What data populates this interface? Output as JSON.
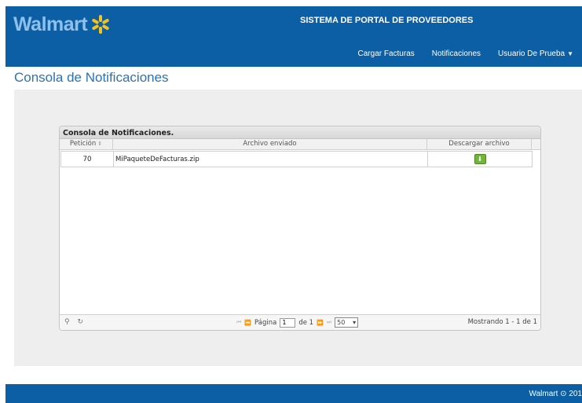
{
  "header": {
    "logo_text": "Walmart",
    "portal_title": "SISTEMA DE PORTAL DE PROVEEDORES",
    "nav": {
      "upload": "Cargar Facturas",
      "notifications": "Notificaciones",
      "user": "Usuario De Prueba"
    }
  },
  "page": {
    "title": "Consola de Notificaciones"
  },
  "grid": {
    "caption": "Consola de Notificaciones.",
    "columns": {
      "peticion": "Petición",
      "archivo": "Archivo enviado",
      "descargar": "Descargar archivo"
    },
    "rows": [
      {
        "peticion": "70",
        "archivo": "MiPaqueteDeFacturas.zip"
      }
    ],
    "pager": {
      "page_label": "Página",
      "page_value": "1",
      "of_label": "de 1",
      "page_size": "50",
      "showing": "Mostrando 1 - 1 de 1"
    }
  },
  "footer": {
    "text": "Walmart ⊙ 201"
  },
  "colors": {
    "brand_blue": "#0d5fa5",
    "logo_blue": "#8ec0ec",
    "spark_yellow": "#f7c21a",
    "download_green": "#73b53a"
  }
}
